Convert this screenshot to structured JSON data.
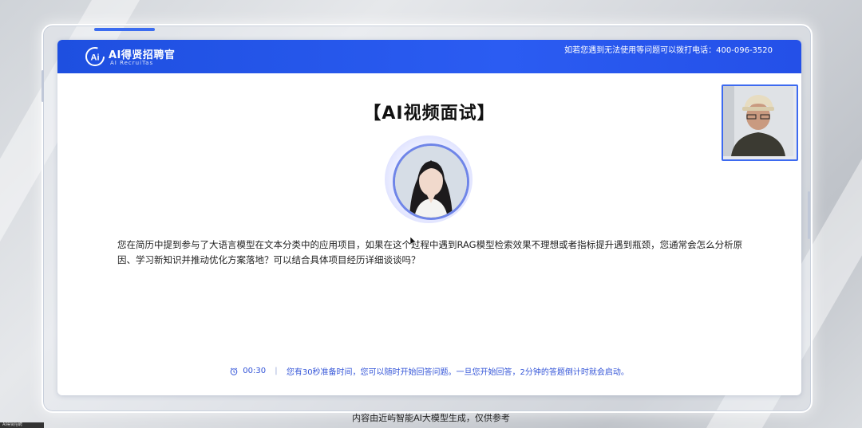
{
  "brand": {
    "name": "AI得贤招聘官",
    "subtitle": "AI RecruiTas"
  },
  "header": {
    "support_text": "如若您遇到无法使用等问题可以拨打电话：400-096-3520"
  },
  "title": "【AI视频面试】",
  "question": "您在简历中提到参与了大语言模型在文本分类中的应用项目，如果在这个过程中遇到RAG模型检索效果不理想或者指标提升遇到瓶颈，您通常会怎么分析原因、学习新知识并推动优化方案落地？可以结合具体项目经历详细谈谈吗？",
  "footer": {
    "timer": "00:30",
    "prep_text": "您有30秒准备时间，您可以随时开始回答问题。一旦您开始回答，2分钟的答题倒计时就会启动。"
  },
  "disclaimer": "内容由近屿智能AI大模型生成，仅供参考",
  "corner_tag": "AI得贤招聘",
  "icons": {
    "timer": "alarm-clock-icon",
    "logo": "ai-logo-icon"
  },
  "colors": {
    "header_blue": "#2b5cf2",
    "accent": "#3556d8"
  }
}
